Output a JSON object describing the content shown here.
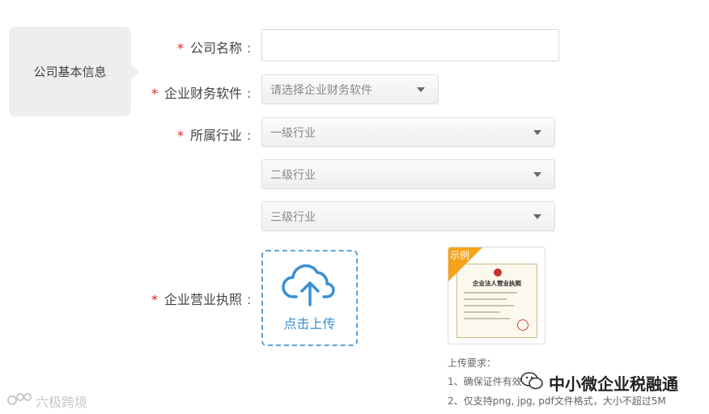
{
  "section": {
    "label": "公司基本信息"
  },
  "form": {
    "required_mark": "*",
    "colon": ":",
    "company_name": {
      "label": "公司名称",
      "value": "",
      "placeholder": ""
    },
    "finance_software": {
      "label": "企业财务软件",
      "selected": "请选择企业财务软件"
    },
    "industry": {
      "label": "所属行业",
      "level1": "一级行业",
      "level2": "二级行业",
      "level3": "三级行业"
    },
    "business_license": {
      "label": "企业营业执照",
      "upload_text": "点击上传",
      "example_label": "示例",
      "example_title": "企业法人营业执照"
    },
    "upload_requirements": {
      "title": "上传要求：",
      "items": [
        "1、确保证件有效",
        "2、仅支持png, jpg, pdf文件格式，大小不超过5M"
      ]
    }
  },
  "watermarks": {
    "right": "中小微企业税融通",
    "left": "六极跨境"
  },
  "colors": {
    "required": "#e0241a",
    "accent": "#3a8fd2",
    "example_ribbon": "#f5a31a"
  }
}
